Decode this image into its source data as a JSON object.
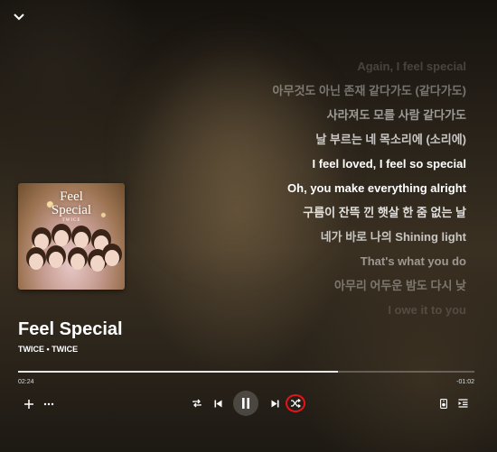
{
  "player": {
    "lyrics": [
      "Again, I feel special",
      "아무것도 아닌 존재 같다가도 (같다가도)",
      "사라져도 모를 사람 같다가도",
      "날 부르는 네 목소리에 (소리에)",
      "I feel loved, I feel so special",
      "Oh, you make everything alright",
      "구름이 잔뜩 낀 햇살 한 줌 없는 날",
      "네가 바로 나의 Shining light",
      "That's what you do",
      "아무리 어두운 밤도 다시 낮",
      "I owe it to you"
    ],
    "album_art": {
      "title_line1": "Feel",
      "title_line2": "Special",
      "artist_tag": "TWICE"
    },
    "track_title": "Feel Special",
    "track_subtitle": "TWICE • TWICE",
    "time_elapsed": "02:24",
    "time_remaining": "-01:02",
    "progress_fraction": 0.7
  },
  "icons": {
    "collapse": "chevron-down-icon",
    "add": "plus-icon",
    "more": "more-horizontal-icon",
    "repeat": "repeat-icon",
    "previous": "skip-previous-icon",
    "play_pause": "pause-icon",
    "next": "skip-next-icon",
    "shuffle": "shuffle-icon",
    "speaker": "speaker-icon",
    "queue": "queue-icon"
  },
  "colors": {
    "highlight": "#e4141b",
    "active_lyric": "#ffffff"
  }
}
